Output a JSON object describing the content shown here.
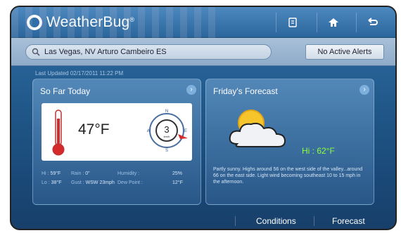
{
  "app": {
    "logo_text": "WeatherBug",
    "logo_trademark": "®"
  },
  "toolbar": {
    "widget_icon": "widget-icon",
    "home_icon": "home-icon",
    "back_icon": "back-icon"
  },
  "search": {
    "value": "Las Vegas, NV Arturo Cambeiro ES",
    "icon": "search-icon"
  },
  "alerts": {
    "label": "No Active Alerts"
  },
  "updated": "Last Updated 02/17/2011 11:22 PM",
  "so_far": {
    "title": "So Far Today",
    "temperature": "47°F",
    "rain_gauge_value": "3",
    "rain_gauge_unit": "km/h",
    "compass": {
      "N": "N",
      "E": "E",
      "S": "S",
      "W": "W"
    },
    "stats": {
      "hi_label": "Hi :",
      "hi_value": "59°F",
      "rain_label": "Rain :",
      "rain_value": "0\"",
      "humidity_label": "Humidity :",
      "humidity_value": "25%",
      "lo_label": "Lo :",
      "lo_value": "38°F",
      "gust_label": "Gust :",
      "gust_value": "WSW 23mph",
      "dew_label": "Dew Point :",
      "dew_value": "12°F"
    }
  },
  "forecast": {
    "title": "Friday's Forecast",
    "hi": "Hi : 62°F",
    "text": "Partly sunny. Highs around 56 on the west side of the valley...around 66 on the east side. Light wind becoming southeast 10 to 15 mph in the afternoon."
  },
  "bottom_tabs": {
    "conditions": "Conditions",
    "forecast": "Forecast"
  },
  "colors": {
    "hi_green": "#8dff3a",
    "accent": "#2f6fa6"
  }
}
